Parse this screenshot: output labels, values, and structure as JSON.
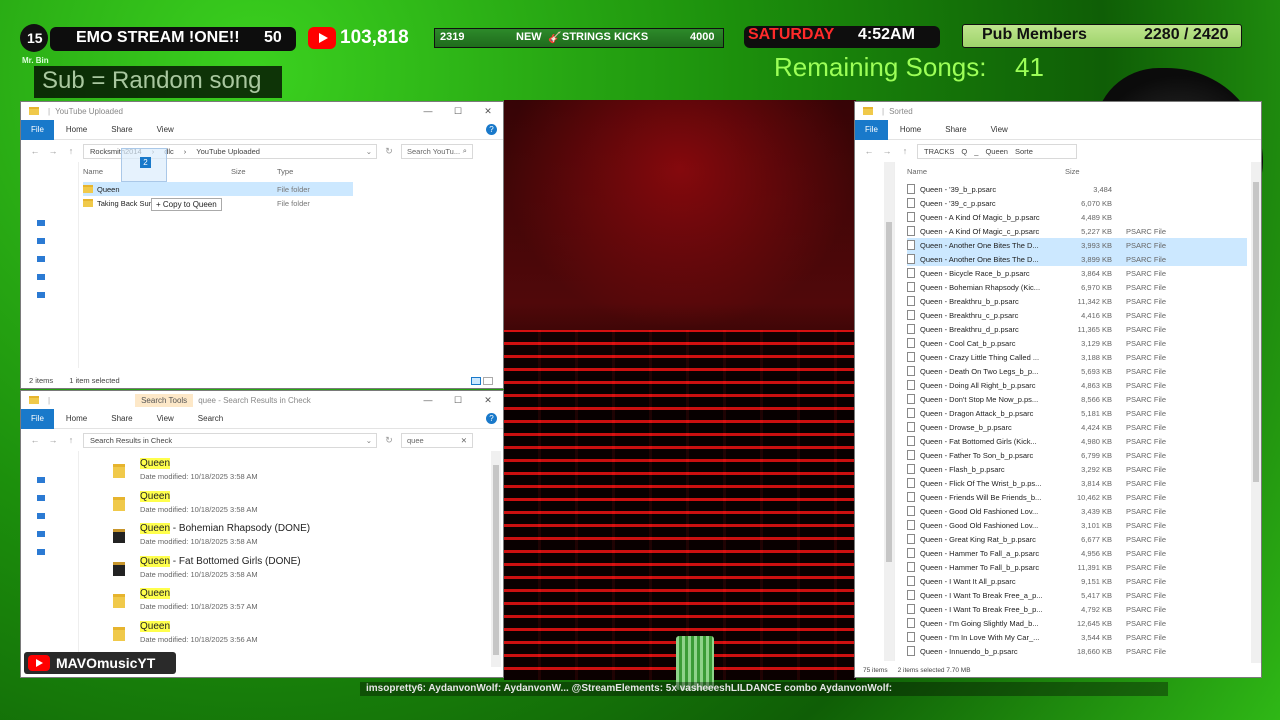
{
  "overlay": {
    "rank": "15",
    "stream_title": "EMO STREAM !ONE!!",
    "level": "50",
    "yt_subs": "103,818",
    "goal_left": "2319",
    "goal_new": "NEW",
    "goal_label": "STRINGS KICKS",
    "goal_right": "4000",
    "day": "SATURDAY",
    "time": "4:52AM",
    "pub_label": "Pub Members",
    "pub_count": "2280 / 2420",
    "sub_line": "Sub = Random song",
    "remaining_label": "Remaining Songs:",
    "remaining_value": "41",
    "channel": "MAVOmusicYT",
    "ticker": "imsopretty6:  AydanvonWolf:    AydanvonW...  @StreamElements: 5x vasheeeshLILDANCE combo   AydanvonWolf:",
    "tiny_label": "Mr. Bin"
  },
  "win_top_left": {
    "title": "YouTube Uploaded",
    "ribbon": [
      "File",
      "Home",
      "Share",
      "View"
    ],
    "address": [
      "Rocksmith2014",
      "dlc",
      "YouTube Uploaded"
    ],
    "search_placeholder": "Search YouTu...",
    "columns": [
      "Name",
      "Size",
      "Type"
    ],
    "rows": [
      {
        "name": "Queen",
        "type": "File folder",
        "selected": true
      },
      {
        "name": "Taking Back Sunday",
        "type": "File folder",
        "selected": false
      }
    ],
    "tooltip": "+ Copy to Queen",
    "drag_count": "2",
    "status_items": "2 items",
    "status_selected": "1 item selected"
  },
  "win_bottom_left": {
    "title": "quee - Search Results in Check",
    "search_tools_tab": "Search Tools",
    "ribbon": [
      "File",
      "Home",
      "Share",
      "View",
      "Search"
    ],
    "address": "Search Results in Check",
    "search_value": "quee",
    "results": [
      {
        "prefix": "Queen",
        "suffix": "",
        "date": "Date modified: 10/18/2025 3:58 AM",
        "album": false
      },
      {
        "prefix": "Queen",
        "suffix": "",
        "date": "Date modified: 10/18/2025 3:58 AM",
        "album": false
      },
      {
        "prefix": "Queen",
        "suffix": " - Bohemian Rhapsody (DONE)",
        "date": "Date modified: 10/18/2025 3:58 AM",
        "album": true
      },
      {
        "prefix": "Queen",
        "suffix": " - Fat Bottomed Girls (DONE)",
        "date": "Date modified: 10/18/2025 3:58 AM",
        "album": true
      },
      {
        "prefix": "Queen",
        "suffix": "",
        "date": "Date modified: 10/18/2025 3:57 AM",
        "album": false
      },
      {
        "prefix": "Queen",
        "suffix": "",
        "date": "Date modified: 10/18/2025 3:56 AM",
        "album": false
      }
    ]
  },
  "win_right": {
    "title": "Sorted",
    "ribbon": [
      "File",
      "Home",
      "Share",
      "View"
    ],
    "address": [
      "TRACKS",
      "Q",
      "_",
      "Queen",
      "Sorte"
    ],
    "columns": [
      "Name",
      "Size"
    ],
    "rows": [
      {
        "name": "Queen - '39_b_p.psarc",
        "size": "3,484",
        "type": "",
        "selected": false
      },
      {
        "name": "Queen - '39_c_p.psarc",
        "size": "6,070 KB",
        "type": "",
        "selected": false
      },
      {
        "name": "Queen - A Kind Of Magic_b_p.psarc",
        "size": "4,489 KB",
        "type": "",
        "selected": false
      },
      {
        "name": "Queen - A Kind Of Magic_c_p.psarc",
        "size": "5,227 KB",
        "type": "PSARC File",
        "selected": false
      },
      {
        "name": "Queen - Another One Bites The D...",
        "size": "3,993 KB",
        "type": "PSARC File",
        "selected": true
      },
      {
        "name": "Queen - Another One Bites The D...",
        "size": "3,899 KB",
        "type": "PSARC File",
        "selected": true
      },
      {
        "name": "Queen - Bicycle Race_b_p.psarc",
        "size": "3,864 KB",
        "type": "PSARC File",
        "selected": false
      },
      {
        "name": "Queen - Bohemian Rhapsody (Kic...",
        "size": "6,970 KB",
        "type": "PSARC File",
        "selected": false
      },
      {
        "name": "Queen - Breakthru_b_p.psarc",
        "size": "11,342 KB",
        "type": "PSARC File",
        "selected": false
      },
      {
        "name": "Queen - Breakthru_c_p.psarc",
        "size": "4,416 KB",
        "type": "PSARC File",
        "selected": false
      },
      {
        "name": "Queen - Breakthru_d_p.psarc",
        "size": "11,365 KB",
        "type": "PSARC File",
        "selected": false
      },
      {
        "name": "Queen - Cool Cat_b_p.psarc",
        "size": "3,129 KB",
        "type": "PSARC File",
        "selected": false
      },
      {
        "name": "Queen - Crazy Little Thing Called ...",
        "size": "3,188 KB",
        "type": "PSARC File",
        "selected": false
      },
      {
        "name": "Queen - Death On Two Legs_b_p...",
        "size": "5,693 KB",
        "type": "PSARC File",
        "selected": false
      },
      {
        "name": "Queen - Doing All Right_b_p.psarc",
        "size": "4,863 KB",
        "type": "PSARC File",
        "selected": false
      },
      {
        "name": "Queen - Don't Stop Me Now_p.ps...",
        "size": "8,566 KB",
        "type": "PSARC File",
        "selected": false
      },
      {
        "name": "Queen - Dragon Attack_b_p.psarc",
        "size": "5,181 KB",
        "type": "PSARC File",
        "selected": false
      },
      {
        "name": "Queen - Drowse_b_p.psarc",
        "size": "4,424 KB",
        "type": "PSARC File",
        "selected": false
      },
      {
        "name": "Queen - Fat Bottomed Girls (Kick...",
        "size": "4,980 KB",
        "type": "PSARC File",
        "selected": false
      },
      {
        "name": "Queen - Father To Son_b_p.psarc",
        "size": "6,799 KB",
        "type": "PSARC File",
        "selected": false
      },
      {
        "name": "Queen - Flash_b_p.psarc",
        "size": "3,292 KB",
        "type": "PSARC File",
        "selected": false
      },
      {
        "name": "Queen - Flick Of The Wrist_b_p.ps...",
        "size": "3,814 KB",
        "type": "PSARC File",
        "selected": false
      },
      {
        "name": "Queen - Friends Will Be Friends_b...",
        "size": "10,462 KB",
        "type": "PSARC File",
        "selected": false
      },
      {
        "name": "Queen - Good Old Fashioned Lov...",
        "size": "3,439 KB",
        "type": "PSARC File",
        "selected": false
      },
      {
        "name": "Queen - Good Old Fashioned Lov...",
        "size": "3,101 KB",
        "type": "PSARC File",
        "selected": false
      },
      {
        "name": "Queen - Great King Rat_b_p.psarc",
        "size": "6,677 KB",
        "type": "PSARC File",
        "selected": false
      },
      {
        "name": "Queen - Hammer To Fall_a_p.psarc",
        "size": "4,956 KB",
        "type": "PSARC File",
        "selected": false
      },
      {
        "name": "Queen - Hammer To Fall_b_p.psarc",
        "size": "11,391 KB",
        "type": "PSARC File",
        "selected": false
      },
      {
        "name": "Queen - I Want It All_p.psarc",
        "size": "9,151 KB",
        "type": "PSARC File",
        "selected": false
      },
      {
        "name": "Queen - I Want To Break Free_a_p...",
        "size": "5,417 KB",
        "type": "PSARC File",
        "selected": false
      },
      {
        "name": "Queen - I Want To Break Free_b_p...",
        "size": "4,792 KB",
        "type": "PSARC File",
        "selected": false
      },
      {
        "name": "Queen - I'm Going Slightly Mad_b...",
        "size": "12,645 KB",
        "type": "PSARC File",
        "selected": false
      },
      {
        "name": "Queen - I'm In Love With My Car_...",
        "size": "3,544 KB",
        "type": "PSARC File",
        "selected": false
      },
      {
        "name": "Queen - Innuendo_b_p.psarc",
        "size": "18,660 KB",
        "type": "PSARC File",
        "selected": false
      }
    ],
    "status_items": "75 items",
    "status_selected": "2 items selected  7.70 MB"
  },
  "colors": {
    "accent_blue": "#1979ca",
    "selection": "#cce8ff",
    "highlight": "#ffff4d",
    "overlay_red": "#ff2a2a",
    "overlay_green_text": "#9cff57"
  }
}
